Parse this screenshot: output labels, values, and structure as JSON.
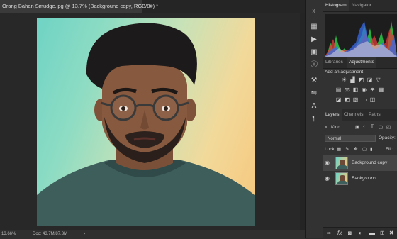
{
  "document": {
    "tab_title": "Orang Bahan Smudge.jpg @ 13.7% (Background copy, RGB/8#) *",
    "close": "×"
  },
  "status": {
    "zoom": "13.66%",
    "doc_info": "Doc: 43.7M/87.3M",
    "arrow": "›"
  },
  "panels": {
    "top_tabs": [
      "Histogram",
      "Navigator"
    ],
    "mid_tabs": [
      "Libraries",
      "Adjustments"
    ],
    "adjustments_title": "Add an adjustment",
    "layers_tabs": [
      "Layers",
      "Channels",
      "Paths"
    ],
    "kind_label": "Kind",
    "blend_mode": "Normal",
    "opacity_label": "Opacity:",
    "lock_label": "Lock:",
    "fill_label": "Fill:",
    "layers": [
      {
        "name": "Background copy",
        "selected": true,
        "italic": false
      },
      {
        "name": "Background",
        "selected": false,
        "italic": true
      }
    ]
  },
  "icons": {
    "search": "⌕",
    "eye": "◉",
    "close": "×"
  }
}
